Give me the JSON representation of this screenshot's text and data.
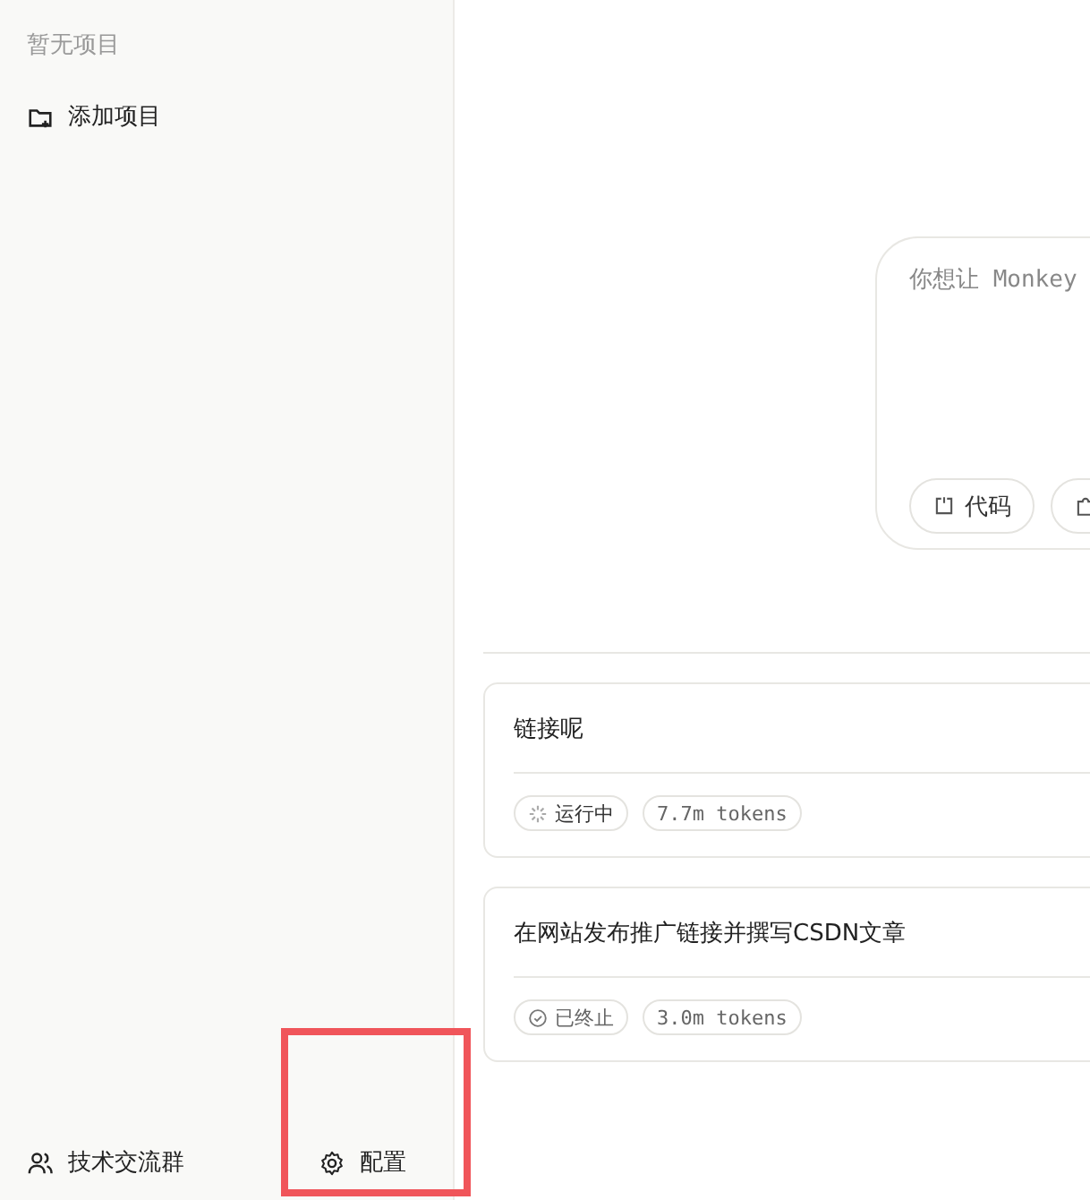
{
  "sidebar": {
    "empty_text": "暂无项目",
    "add_project": "添加项目",
    "footer": [
      {
        "kind": "group",
        "label": "技术交流群"
      },
      {
        "kind": "settings",
        "label": "配置"
      }
    ]
  },
  "prompt": {
    "placeholder": "你想让 Monkey",
    "chips": [
      {
        "kind": "code",
        "label": "代码"
      },
      {
        "kind": "plugin"
      }
    ]
  },
  "tasks": [
    {
      "title": "链接呢",
      "status": {
        "kind": "running",
        "label": "运行中"
      },
      "tokens": "7.7m tokens"
    },
    {
      "title": "在网站发布推广链接并撰写CSDN文章",
      "status": {
        "kind": "stopped",
        "label": "已终止"
      },
      "tokens": "3.0m tokens"
    }
  ]
}
